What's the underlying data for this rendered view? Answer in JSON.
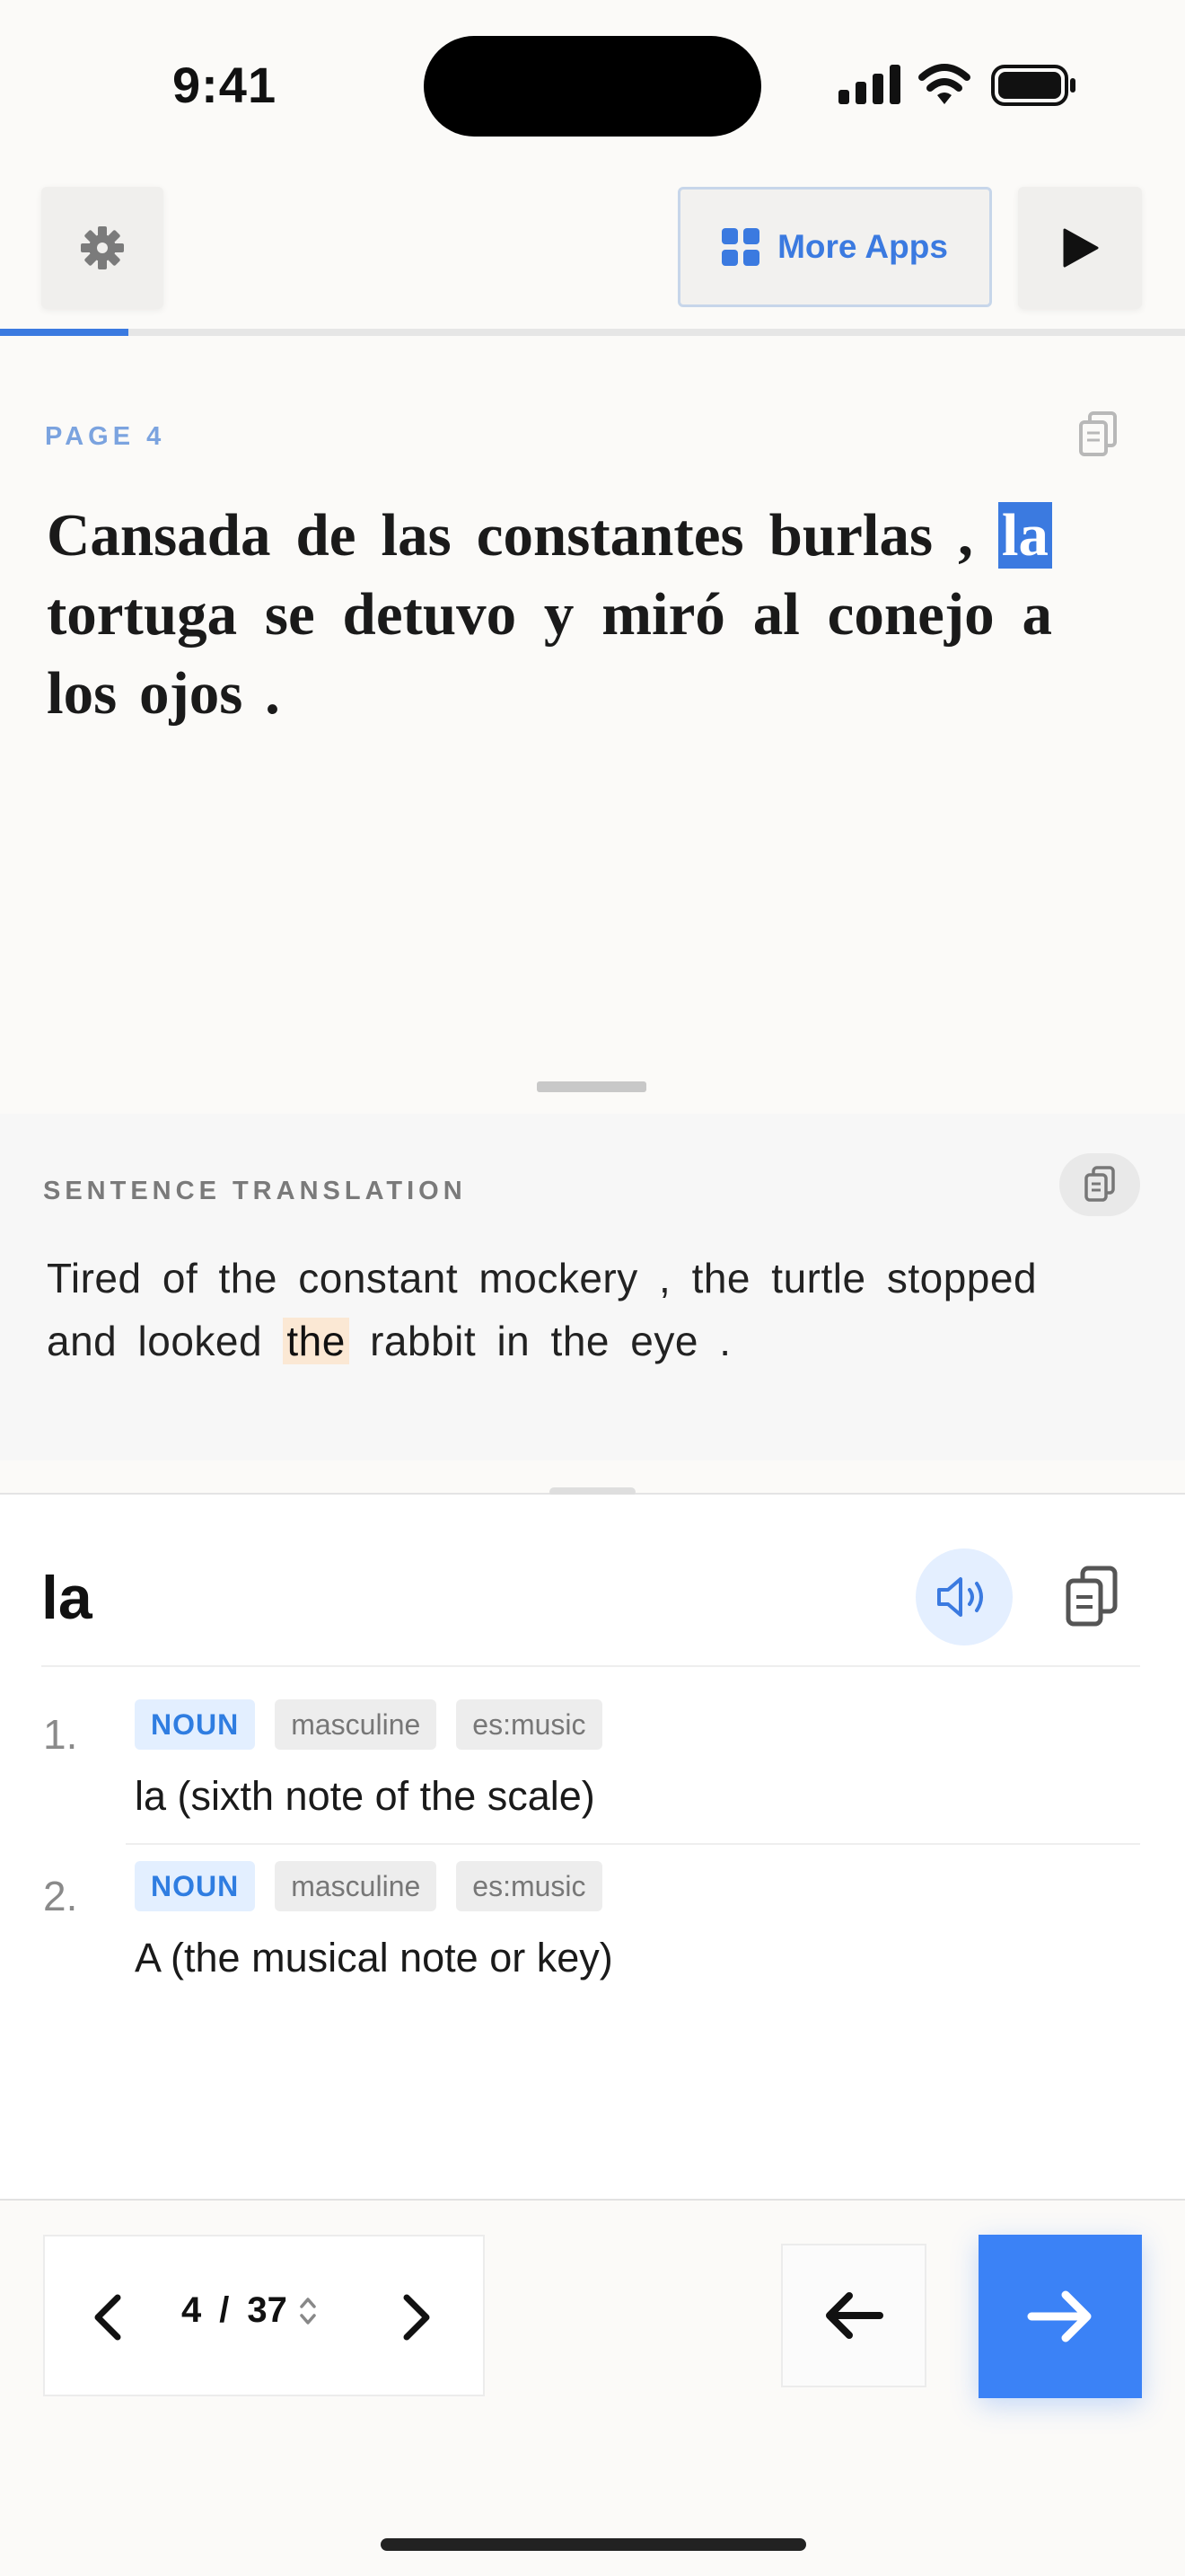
{
  "status_bar": {
    "time": "9:41"
  },
  "toolbar": {
    "settings_icon": "gear-icon",
    "more_apps_label": "More Apps",
    "more_apps_icon": "grid-icon",
    "play_icon": "play-icon",
    "accent_color": "#3b7ae0"
  },
  "progress": {
    "current_page": 4,
    "total_pages": 37,
    "fraction": 0.108
  },
  "reading": {
    "page_label": "PAGE  4",
    "sentence_before": "Cansada de las constantes burlas , ",
    "highlighted_word": "la",
    "sentence_after": " tortuga se detuvo y miró al conejo a los ojos ."
  },
  "translation": {
    "heading": "SENTENCE TRANSLATION",
    "text_before": "Tired of the constant mockery , the turtle stopped and looked ",
    "highlighted": "the",
    "text_after": " rabbit in the eye ."
  },
  "dictionary": {
    "word": "la",
    "definitions": [
      {
        "number": "1.",
        "pos": "NOUN",
        "gender": "masculine",
        "domain": "es:music",
        "text": "la (sixth note of the scale)"
      },
      {
        "number": "2.",
        "pos": "NOUN",
        "gender": "masculine",
        "domain": "es:music",
        "text": "A (the musical note or key)"
      }
    ]
  },
  "pager": {
    "current": "4",
    "separator": "/",
    "total": "37"
  }
}
